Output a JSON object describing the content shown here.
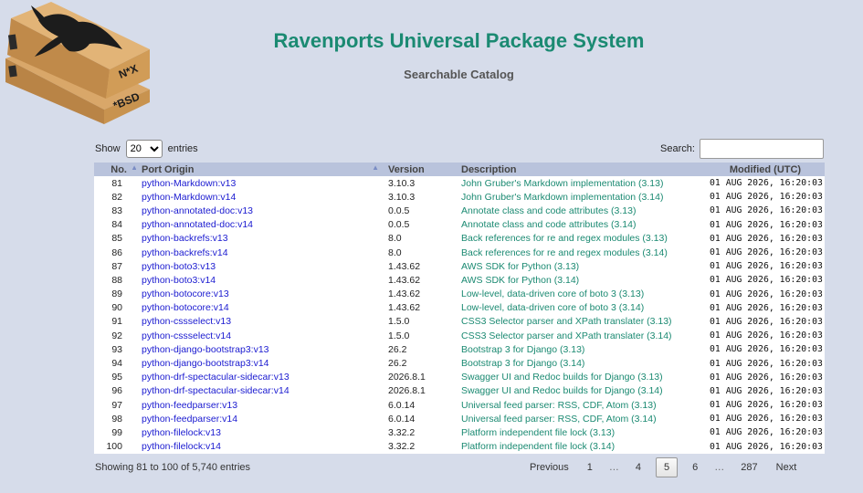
{
  "header": {
    "title": "Ravenports Universal Package System",
    "subtitle": "Searchable Catalog",
    "logo_text_top": "N*X",
    "logo_text_bottom": "*BSD"
  },
  "controls": {
    "show_label": "Show",
    "page_size": "20",
    "entries_label": "entries",
    "search_label": "Search:",
    "search_value": ""
  },
  "table": {
    "columns": [
      "No.",
      "Port Origin",
      "Version",
      "Description",
      "Modified (UTC)"
    ],
    "rows": [
      {
        "no": "81",
        "origin": "python-Markdown:v13",
        "version": "3.10.3",
        "desc": "John Gruber's Markdown implementation (3.13)",
        "mod": "01 AUG 2026, 16:20:03"
      },
      {
        "no": "82",
        "origin": "python-Markdown:v14",
        "version": "3.10.3",
        "desc": "John Gruber's Markdown implementation (3.14)",
        "mod": "01 AUG 2026, 16:20:03"
      },
      {
        "no": "83",
        "origin": "python-annotated-doc:v13",
        "version": "0.0.5",
        "desc": "Annotate class and code attributes (3.13)",
        "mod": "01 AUG 2026, 16:20:03"
      },
      {
        "no": "84",
        "origin": "python-annotated-doc:v14",
        "version": "0.0.5",
        "desc": "Annotate class and code attributes (3.14)",
        "mod": "01 AUG 2026, 16:20:03"
      },
      {
        "no": "85",
        "origin": "python-backrefs:v13",
        "version": "8.0",
        "desc": "Back references for re and regex modules (3.13)",
        "mod": "01 AUG 2026, 16:20:03"
      },
      {
        "no": "86",
        "origin": "python-backrefs:v14",
        "version": "8.0",
        "desc": "Back references for re and regex modules (3.14)",
        "mod": "01 AUG 2026, 16:20:03"
      },
      {
        "no": "87",
        "origin": "python-boto3:v13",
        "version": "1.43.62",
        "desc": "AWS SDK for Python (3.13)",
        "mod": "01 AUG 2026, 16:20:03"
      },
      {
        "no": "88",
        "origin": "python-boto3:v14",
        "version": "1.43.62",
        "desc": "AWS SDK for Python (3.14)",
        "mod": "01 AUG 2026, 16:20:03"
      },
      {
        "no": "89",
        "origin": "python-botocore:v13",
        "version": "1.43.62",
        "desc": "Low-level, data-driven core of boto 3 (3.13)",
        "mod": "01 AUG 2026, 16:20:03"
      },
      {
        "no": "90",
        "origin": "python-botocore:v14",
        "version": "1.43.62",
        "desc": "Low-level, data-driven core of boto 3 (3.14)",
        "mod": "01 AUG 2026, 16:20:03"
      },
      {
        "no": "91",
        "origin": "python-cssselect:v13",
        "version": "1.5.0",
        "desc": "CSS3 Selector parser and XPath translater (3.13)",
        "mod": "01 AUG 2026, 16:20:03"
      },
      {
        "no": "92",
        "origin": "python-cssselect:v14",
        "version": "1.5.0",
        "desc": "CSS3 Selector parser and XPath translater (3.14)",
        "mod": "01 AUG 2026, 16:20:03"
      },
      {
        "no": "93",
        "origin": "python-django-bootstrap3:v13",
        "version": "26.2",
        "desc": "Bootstrap 3 for Django (3.13)",
        "mod": "01 AUG 2026, 16:20:03"
      },
      {
        "no": "94",
        "origin": "python-django-bootstrap3:v14",
        "version": "26.2",
        "desc": "Bootstrap 3 for Django (3.14)",
        "mod": "01 AUG 2026, 16:20:03"
      },
      {
        "no": "95",
        "origin": "python-drf-spectacular-sidecar:v13",
        "version": "2026.8.1",
        "desc": "Swagger UI and Redoc builds for Django (3.13)",
        "mod": "01 AUG 2026, 16:20:03"
      },
      {
        "no": "96",
        "origin": "python-drf-spectacular-sidecar:v14",
        "version": "2026.8.1",
        "desc": "Swagger UI and Redoc builds for Django (3.14)",
        "mod": "01 AUG 2026, 16:20:03"
      },
      {
        "no": "97",
        "origin": "python-feedparser:v13",
        "version": "6.0.14",
        "desc": "Universal feed parser: RSS, CDF, Atom (3.13)",
        "mod": "01 AUG 2026, 16:20:03"
      },
      {
        "no": "98",
        "origin": "python-feedparser:v14",
        "version": "6.0.14",
        "desc": "Universal feed parser: RSS, CDF, Atom (3.14)",
        "mod": "01 AUG 2026, 16:20:03"
      },
      {
        "no": "99",
        "origin": "python-filelock:v13",
        "version": "3.32.2",
        "desc": "Platform independent file lock (3.13)",
        "mod": "01 AUG 2026, 16:20:03"
      },
      {
        "no": "100",
        "origin": "python-filelock:v14",
        "version": "3.32.2",
        "desc": "Platform independent file lock (3.14)",
        "mod": "01 AUG 2026, 16:20:03"
      }
    ]
  },
  "footer": {
    "info": "Showing 81 to 100 of 5,740 entries",
    "previous": "Previous",
    "next": "Next",
    "pages": [
      "1",
      "…",
      "4",
      "5",
      "6",
      "…",
      "287"
    ],
    "current_page": "5"
  },
  "colors": {
    "background": "#d6dcea",
    "title": "#1b8a72",
    "link": "#1a1ad0",
    "header_row": "#b9c3dc"
  }
}
